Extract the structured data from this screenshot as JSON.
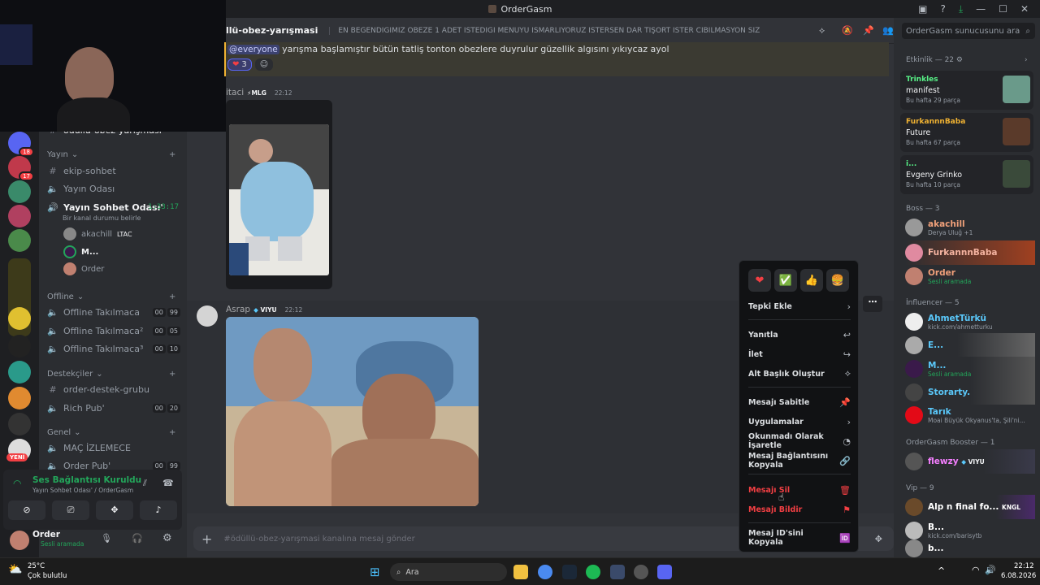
{
  "window": {
    "title": "OrderGasm"
  },
  "channel": {
    "name": "llü-obez-yarışmasi",
    "topic": "EN BEĞENDİĞİMİZ OBEZE 1 ADET İSTEDİĞİ MENÜYÜ ISMARLIYORUZ İSTERSEN DAR TİŞÖRT İSTER CIBILMASYON SİZE KALMIŞ",
    "search_placeholder": "OrderGasm sunucusunu ara",
    "input_placeholder": "#ödüllü-obez-yarışmasi kanalına mesaj gönder"
  },
  "rail": {
    "badges": [
      "18",
      "17"
    ],
    "new_label": "YENİ"
  },
  "sidebar": {
    "partial_channel": "ödüllü-obez-yarışması",
    "categories": [
      {
        "name": "Yayın",
        "channels": [
          "ekip-sohbet",
          "Yayın Odası",
          "Yayın Sohbet Odası'"
        ]
      },
      {
        "name": "Offline",
        "channels": [
          "Offline Takılmaca",
          "Offline Takılmaca²",
          "Offline Takılmaca³"
        ]
      },
      {
        "name": "Destekçiler",
        "channels": [
          "order-destek-grubu",
          "Rich Pub'"
        ]
      },
      {
        "name": "Genel",
        "channels": [
          "MAÇ İZLEMECE",
          "Order Pub'"
        ]
      }
    ],
    "voice_timer": "1:33:17",
    "voice_status": "Bir kanal durumu belirle",
    "voice_users": [
      {
        "name": "akachill",
        "tag": "LTAC"
      },
      {
        "name": "M..."
      },
      {
        "name": "Order"
      }
    ],
    "counts": {
      "offline1": [
        "00",
        "99"
      ],
      "offline2": [
        "00",
        "05"
      ],
      "offline3": [
        "00",
        "10"
      ],
      "richpub": [
        "00",
        "20"
      ],
      "orderpub": [
        "00",
        "99"
      ]
    }
  },
  "voice_panel": {
    "status": "Ses Bağlantısı Kuruldu",
    "location": "Yayın Sohbet Odası' / OrderGasm"
  },
  "user_panel": {
    "name": "Order",
    "status": "Sesli aramada"
  },
  "messages": {
    "everyone": {
      "mention": "@everyone",
      "text": "yarışma başlamıştır bütün tatliş tonton obezlere duyrulur güzellik algısını yıkıycaz ayol",
      "reaction_count": "3"
    },
    "msg1": {
      "author": "itaci",
      "tag": "MLG",
      "time": "22:12"
    },
    "msg2": {
      "author": "Asrap",
      "tag": "VIYU",
      "time": "22:12"
    }
  },
  "context_menu": {
    "quick_reactions": [
      "❤",
      "✅",
      "👍",
      "🍔"
    ],
    "items": [
      "Tepki Ekle",
      "Yanıtla",
      "İlet",
      "Alt Başlık Oluştur",
      "Mesajı Sabitle",
      "Uygulamalar",
      "Okunmadı Olarak İşaretle",
      "Mesaj Bağlantısını Kopyala",
      "Mesajı Sil",
      "Mesajı Bildir",
      "Mesaj ID'sini Kopyala"
    ]
  },
  "members": {
    "activity_header": "Etkinlik — 22",
    "activities": [
      {
        "name": "Trinkles",
        "title": "manifest",
        "weekly": "Bu hafta 29 parça",
        "color": "#57f287"
      },
      {
        "name": "FurkannnBaba",
        "title": "Future",
        "weekly": "Bu hafta 67 parça",
        "color": "#f0b232"
      },
      {
        "name": "i...",
        "title": "Evgeny Grinko",
        "weekly": "Bu hafta 10 parça",
        "color": "#57f287"
      }
    ],
    "groups": [
      {
        "header": "Boss — 3",
        "members": [
          {
            "name": "akachill",
            "sub": "Derya Uluğ +1",
            "tag": "LTAC",
            "color": "#f0a07a"
          },
          {
            "name": "FurkannnBaba",
            "sub": "",
            "color": "#f4b3a0"
          },
          {
            "name": "Order",
            "sub": "Sesli aramada",
            "color": "#f0a07a"
          }
        ]
      },
      {
        "header": "İnfluencer — 5",
        "members": [
          {
            "name": "AhmetTürkü",
            "sub": "kick.com/ahmetturku",
            "color": "#5ac8fa"
          },
          {
            "name": "E...",
            "sub": "",
            "color": "#5ac8fa"
          },
          {
            "name": "M...",
            "sub": "Sesli aramada",
            "color": "#5ac8fa"
          },
          {
            "name": "Storarty.",
            "sub": "",
            "color": "#5ac8fa"
          },
          {
            "name": "Tarık",
            "sub": "Moai Büyük Okyanus'ta, Şili'ni...",
            "color": "#5ac8fa"
          }
        ]
      },
      {
        "header": "OrderGasm Booster — 1",
        "members": [
          {
            "name": "flewzy",
            "sub": "",
            "tag": "VIYU",
            "color": "#f47fff"
          }
        ]
      },
      {
        "header": "Vip — 9",
        "members": [
          {
            "name": "Alp n final fo...",
            "sub": "",
            "tag": "KNGL",
            "color": "#ffffff"
          },
          {
            "name": "B...",
            "sub": "kick.com/barisytb",
            "color": "#ffffff"
          },
          {
            "name": "b...",
            "sub": "",
            "color": "#ffffff"
          }
        ]
      }
    ]
  },
  "taskbar": {
    "weather_temp": "25°C",
    "weather_desc": "Çok bulutlu",
    "search_label": "Ara",
    "time": "22:12",
    "date": "6.08.2026"
  }
}
